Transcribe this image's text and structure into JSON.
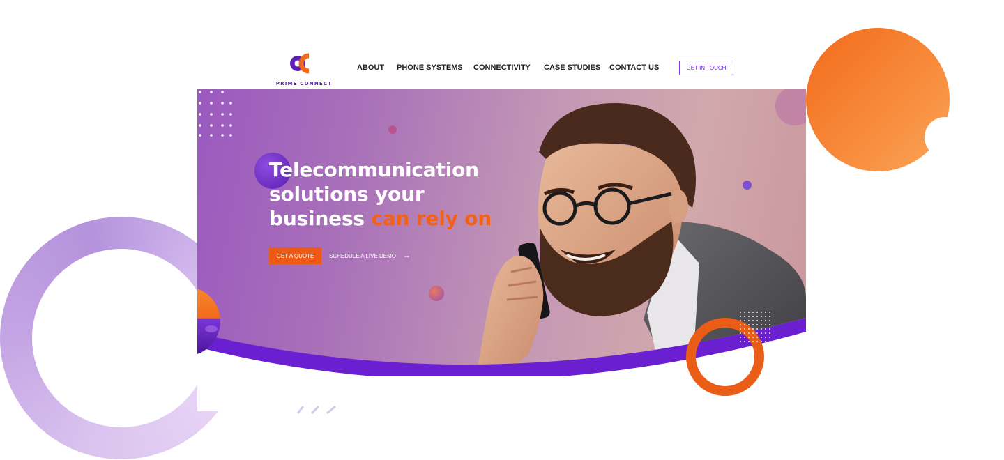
{
  "brand": {
    "name": "PRIME CONNECT",
    "colors": {
      "purple": "#5b21b6",
      "orange": "#f26a1b",
      "accent_text": "#f2611a"
    }
  },
  "nav": {
    "items": [
      {
        "label": "ABOUT"
      },
      {
        "label": "PHONE SYSTEMS"
      },
      {
        "label": "CONNECTIVITY"
      },
      {
        "label": "CASE STUDIES"
      },
      {
        "label": "CONTACT US"
      }
    ],
    "cta_label": "GET IN TOUCH"
  },
  "hero": {
    "headline_line1": "Telecommunication",
    "headline_line2": "solutions your",
    "headline_line3_white": "business",
    "headline_line3_accent": "can rely on",
    "primary_button": "GET A QUOTE",
    "secondary_link": "SCHEDULE A LIVE DEMO",
    "secondary_icon": "arrow-right-icon",
    "image": "man-on-phone-photo"
  }
}
